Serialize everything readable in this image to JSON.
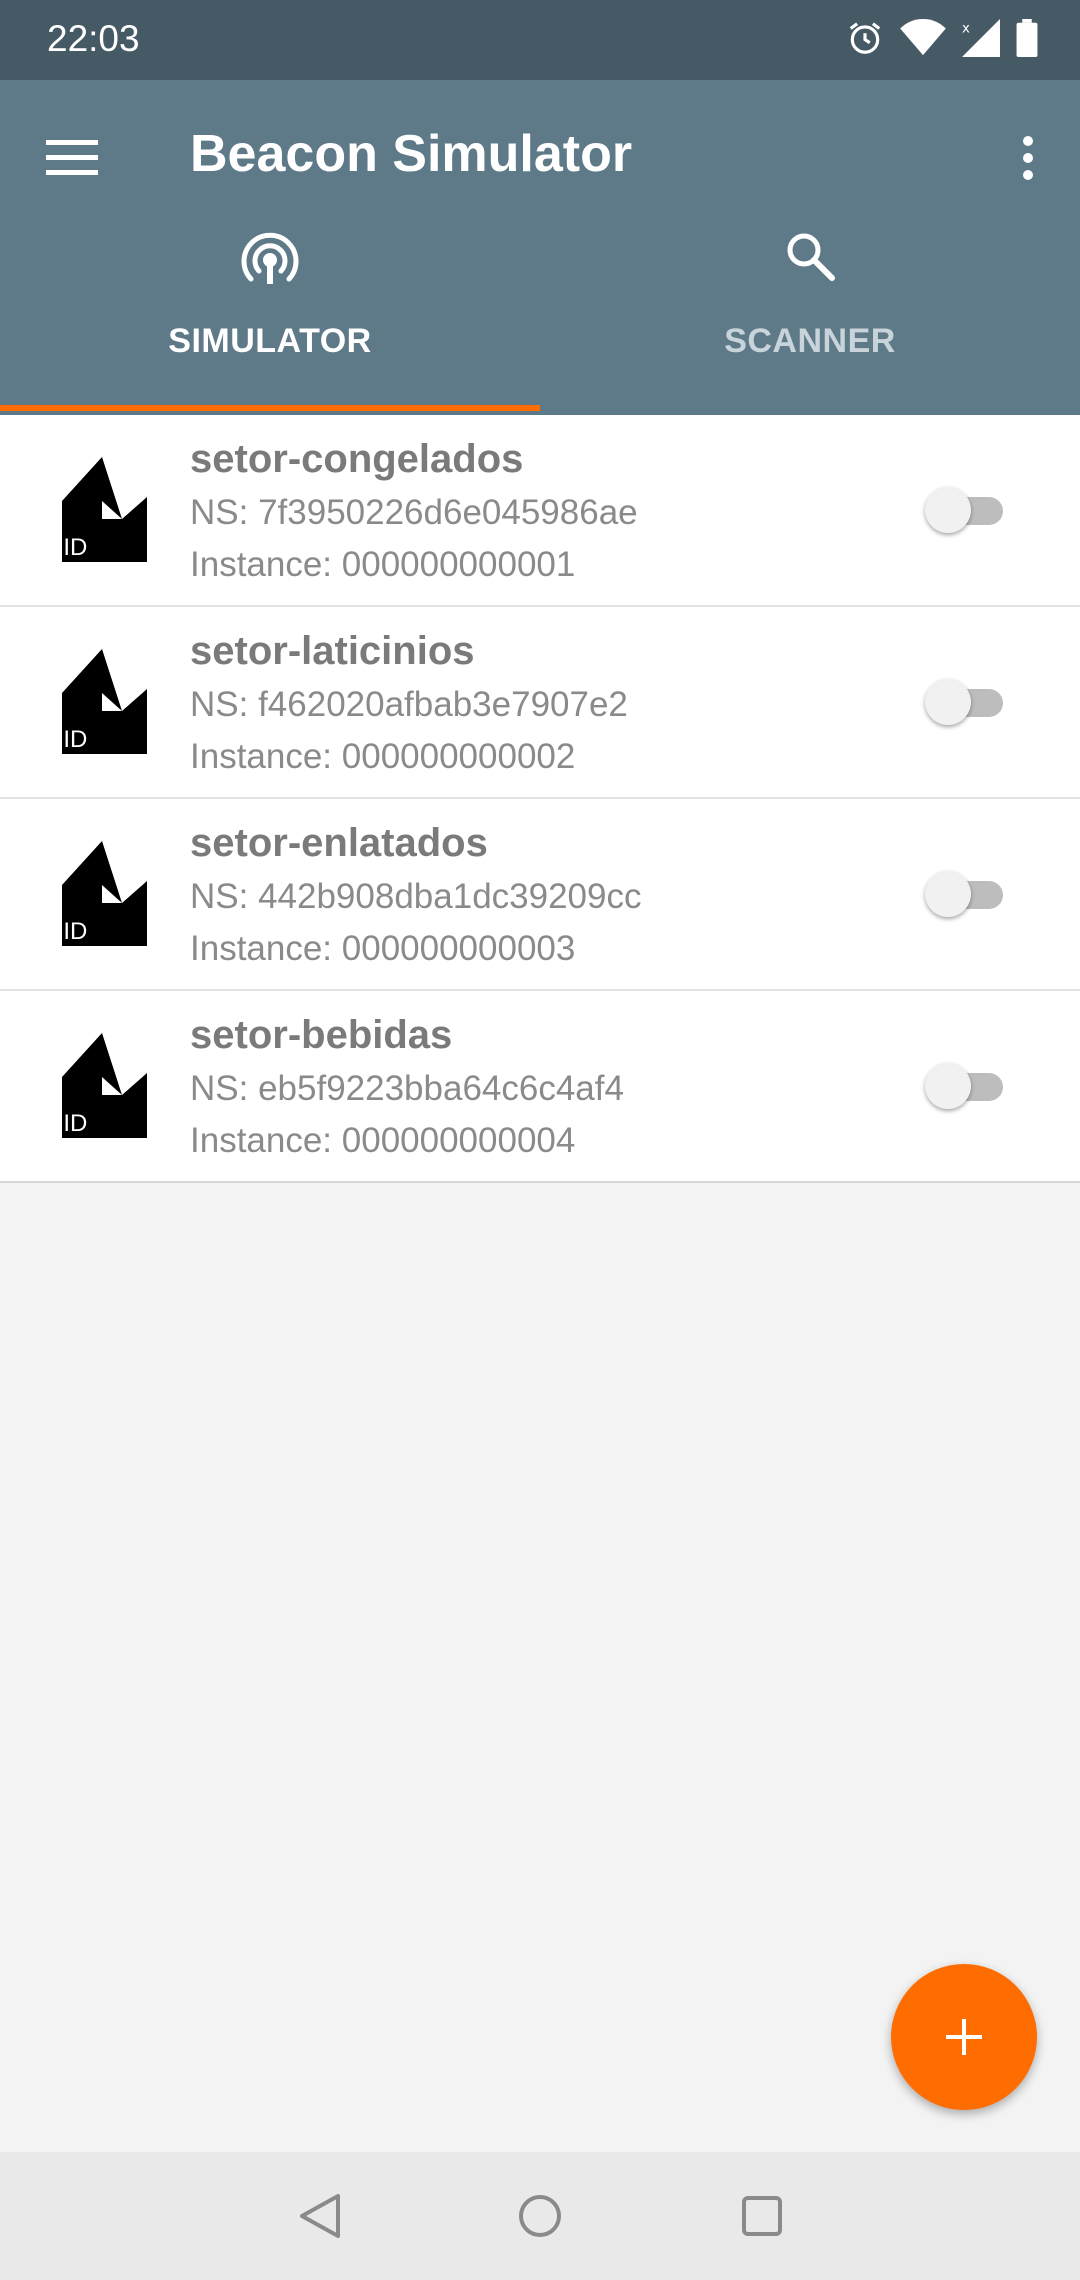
{
  "status_bar": {
    "time": "22:03",
    "icons": [
      "alarm-icon",
      "wifi-icon",
      "signal-icon",
      "battery-icon"
    ]
  },
  "app_bar": {
    "title": "Beacon Simulator",
    "menu_icon": "hamburger-menu-icon",
    "overflow_icon": "more-vertical-icon",
    "background_color": "#5e7a89"
  },
  "tabs": [
    {
      "label": "SIMULATOR",
      "icon": "broadcast-icon",
      "selected": true
    },
    {
      "label": "SCANNER",
      "icon": "search-icon",
      "selected": false
    }
  ],
  "beacons": [
    {
      "name": "setor-congelados",
      "ns": "NS: 7f3950226d6e045986ae",
      "instance": "Instance: 000000000001",
      "icon_label": "UID",
      "enabled": false
    },
    {
      "name": "setor-laticinios",
      "ns": "NS: f462020afbab3e7907e2",
      "instance": "Instance: 000000000002",
      "icon_label": "UID",
      "enabled": false
    },
    {
      "name": "setor-enlatados",
      "ns": "NS: 442b908dba1dc39209cc",
      "instance": "Instance: 000000000003",
      "icon_label": "UID",
      "enabled": false
    },
    {
      "name": "setor-bebidas",
      "ns": "NS: eb5f9223bba64c6c4af4",
      "instance": "Instance: 000000000004",
      "icon_label": "UID",
      "enabled": false
    }
  ],
  "fab": {
    "icon": "add-icon",
    "color": "#ff6d00"
  },
  "nav_bar": {
    "icons": [
      "back-icon",
      "home-icon",
      "recents-icon"
    ]
  },
  "colors": {
    "accent": "#ff6d00",
    "status_bar": "#465a66"
  }
}
